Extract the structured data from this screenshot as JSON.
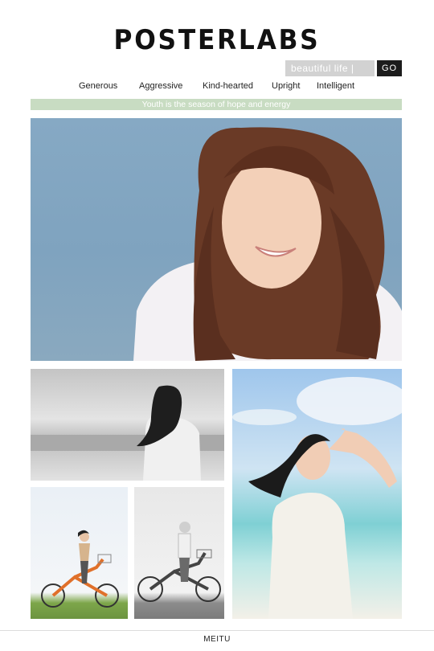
{
  "header": {
    "brand": "POSTERLABS",
    "search": {
      "value": "beautiful  life  |"
    },
    "go_label": "GO"
  },
  "nav": {
    "items": [
      {
        "label": "Generous"
      },
      {
        "label": "Aggressive"
      },
      {
        "label": "Kind-hearted"
      },
      {
        "label": "Upright"
      },
      {
        "label": "Intelligent"
      }
    ]
  },
  "tagline": "Youth is the season of hope and energy",
  "footer": {
    "label": "MEITU"
  },
  "colors": {
    "tagline_bar": "#c8dcc2",
    "go_button": "#1c1c1c",
    "search_box": "#d2d2d2"
  }
}
